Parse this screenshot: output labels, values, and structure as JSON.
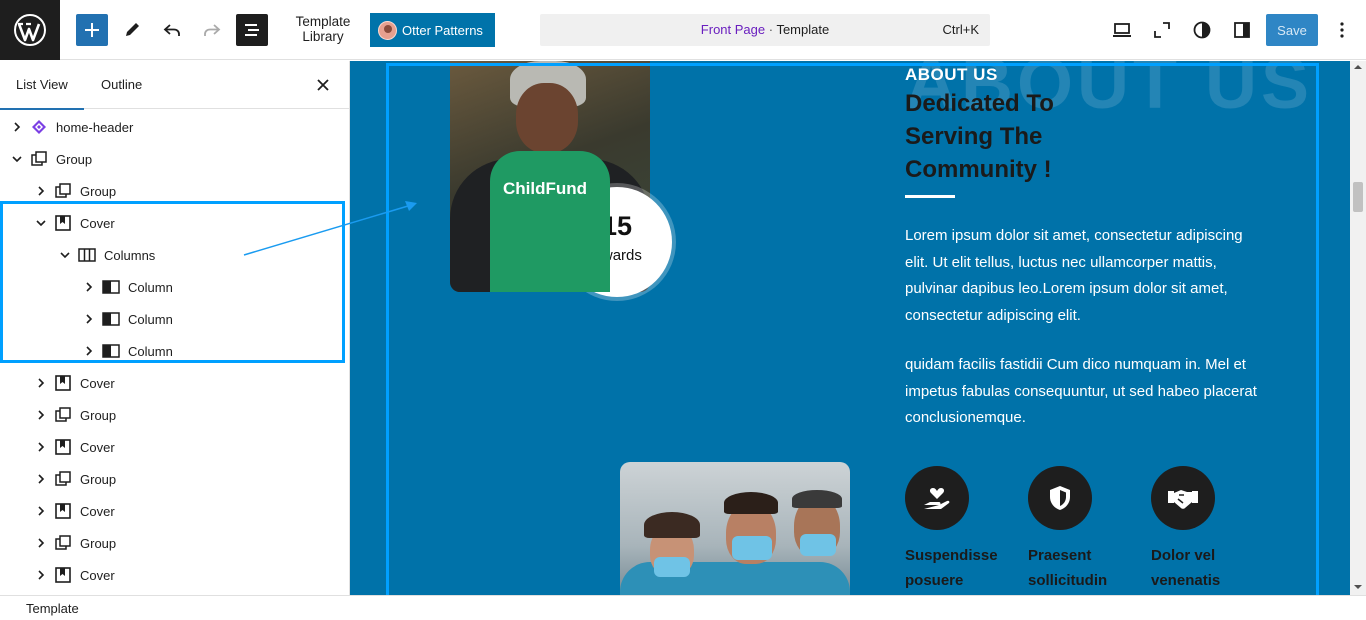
{
  "toolbar": {
    "template_library_label": "Template Library",
    "otter_patterns_label": "Otter Patterns",
    "command_bar": {
      "page": "Front Page",
      "separator": " · ",
      "type": "Template",
      "shortcut": "Ctrl+K"
    },
    "save_label": "Save",
    "icons": [
      "wordpress-logo",
      "plus",
      "pencil",
      "undo",
      "redo",
      "document-overview",
      "desktop-view",
      "fullscreen",
      "styles",
      "settings",
      "more-options"
    ]
  },
  "sidebar": {
    "tabs": [
      {
        "label": "List View",
        "active": true
      },
      {
        "label": "Outline",
        "active": false
      }
    ],
    "tree": [
      {
        "label": "home-header",
        "icon": "template-part",
        "depth": 0,
        "expanded": false
      },
      {
        "label": "Group",
        "icon": "group",
        "depth": 0,
        "expanded": true
      },
      {
        "label": "Group",
        "icon": "group",
        "depth": 1,
        "expanded": false
      },
      {
        "label": "Cover",
        "icon": "cover",
        "depth": 1,
        "expanded": true
      },
      {
        "label": "Columns",
        "icon": "columns",
        "depth": 2,
        "expanded": true
      },
      {
        "label": "Column",
        "icon": "column",
        "depth": 3,
        "expanded": false
      },
      {
        "label": "Column",
        "icon": "column",
        "depth": 3,
        "expanded": false
      },
      {
        "label": "Column",
        "icon": "column",
        "depth": 3,
        "expanded": false
      },
      {
        "label": "Cover",
        "icon": "cover",
        "depth": 1,
        "expanded": false
      },
      {
        "label": "Group",
        "icon": "group",
        "depth": 1,
        "expanded": false
      },
      {
        "label": "Cover",
        "icon": "cover",
        "depth": 1,
        "expanded": false
      },
      {
        "label": "Group",
        "icon": "group",
        "depth": 1,
        "expanded": false
      },
      {
        "label": "Cover",
        "icon": "cover",
        "depth": 1,
        "expanded": false
      },
      {
        "label": "Group",
        "icon": "group",
        "depth": 1,
        "expanded": false
      },
      {
        "label": "Cover",
        "icon": "cover",
        "depth": 1,
        "expanded": false
      }
    ]
  },
  "canvas": {
    "background_title": "ABOUT US",
    "eyebrow": "ABOUT US",
    "headline": "Dedicated To Serving The Community !",
    "paragraph1": "Lorem ipsum dolor sit amet, consectetur adipiscing elit. Ut elit tellus, luctus nec ullamcorper mattis, pulvinar dapibus leo.Lorem ipsum dolor sit amet, consectetur adipiscing elit.",
    "paragraph2": "quidam facilis fastidii Cum dico numquam in. Mel et impetus fabulas consequuntur, ut sed habeo placerat conclusionemque.",
    "photo_brand_text": "ChildFund",
    "award": {
      "number": "15",
      "label": "Awards"
    },
    "features": [
      {
        "title": "Suspendisse posuere",
        "icon": "hand-heart"
      },
      {
        "title": "Praesent sollicitudin",
        "icon": "shield"
      },
      {
        "title": "Dolor vel venenatis",
        "icon": "handshake"
      }
    ],
    "colors": {
      "background": "#0072a9",
      "selection": "#00a0ff",
      "accent": "#2271b1"
    }
  },
  "footer": {
    "breadcrumb": "Template"
  }
}
